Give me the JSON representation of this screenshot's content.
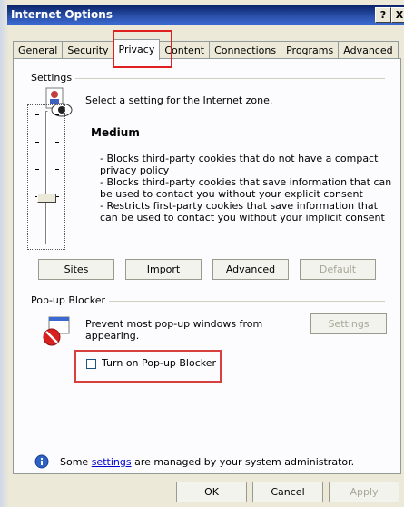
{
  "window": {
    "title": "Internet Options",
    "help_button": "?",
    "close_button": "X"
  },
  "tabs": [
    {
      "label": "General"
    },
    {
      "label": "Security"
    },
    {
      "label": "Privacy"
    },
    {
      "label": "Content"
    },
    {
      "label": "Connections"
    },
    {
      "label": "Programs"
    },
    {
      "label": "Advanced"
    }
  ],
  "settings": {
    "group_label": "Settings",
    "prompt": "Select a setting for the Internet zone.",
    "level": "Medium",
    "descriptions": [
      "- Blocks third-party cookies that do not have a compact",
      "privacy policy",
      "- Blocks third-party cookies that save information that can",
      "be used to contact you without your explicit consent",
      "- Restricts first-party cookies that save information that",
      "can be used to contact you without your implicit consent"
    ],
    "buttons": {
      "sites": "Sites",
      "import": "Import",
      "advanced": "Advanced",
      "default": "Default"
    }
  },
  "popup_blocker": {
    "group_label": "Pop-up Blocker",
    "description_line1": "Prevent most pop-up windows from",
    "description_line2": "appearing.",
    "settings_button": "Settings",
    "checkbox_label": "Turn on Pop-up Blocker"
  },
  "footer": {
    "notice_prefix": "Some ",
    "notice_link": "settings",
    "notice_suffix": " are managed by your system administrator.",
    "ok_button": "OK",
    "cancel_button": "Cancel",
    "apply_button": "Apply"
  },
  "colors": {
    "highlight_box": "#e02020",
    "title_bar": "#0a246a"
  }
}
